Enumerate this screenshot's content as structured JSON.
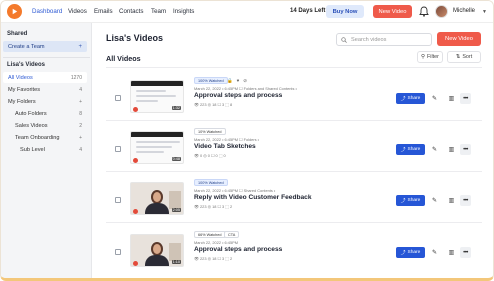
{
  "nav": {
    "links": [
      "Dashboard",
      "Videos",
      "Emails",
      "Contacts",
      "Team",
      "Insights"
    ],
    "days_left": "14 Days Left",
    "buy_now": "Buy Now",
    "new_video": "New Video",
    "user_name": "Michelle",
    "active_link": "Dashboard"
  },
  "sidebar": {
    "shared_heading": "Shared",
    "create_team": "Create a Team",
    "create_team_icon": "plus-icon",
    "lisa_heading": "Lisa's Videos",
    "items": [
      {
        "label": "All Videos",
        "count": "1270"
      },
      {
        "label": "My Favorites",
        "count": "4"
      },
      {
        "label": "My Folders",
        "count": "+"
      },
      {
        "label": "Auto Folders",
        "count": "8"
      },
      {
        "label": "Sales Videos",
        "count": "2"
      },
      {
        "label": "Team Onboarding",
        "count": "+"
      },
      {
        "label": "Sub Level",
        "count": "4"
      }
    ]
  },
  "main": {
    "title": "Lisa's Videos",
    "search_placeholder": "Search videos",
    "new_video": "New Video",
    "section_title": "All Videos",
    "filter_label": "Filter",
    "sort_label": "Sort",
    "share_label": "Share"
  },
  "videos": [
    {
      "badge": "100% Watched",
      "badge_style": "watched",
      "extra_badge": "",
      "badge_icons": [
        "lock-icon",
        "heart-icon",
        "link-icon"
      ],
      "meta": "March 22, 2022 • 6:45PM  ☐ Folders and Shared Contents •",
      "title": "Approval steps and process",
      "stats": "👁 223   ◎ 18   ☐ 3   ⬚ 8",
      "thumb": "screen",
      "duration": "1:32"
    },
    {
      "badge": "10% Watched",
      "badge_style": "plain",
      "extra_badge": "",
      "badge_icons": [],
      "meta": "March 22, 2022 • 6:45PM  ☐ Folders •",
      "title": "Video Tab Sketches",
      "stats": "👁 0   ◎ 0   ☐ 0   ⬚ 0",
      "thumb": "screen",
      "duration": "0:48"
    },
    {
      "badge": "100% Watched",
      "badge_style": "watched",
      "extra_badge": "",
      "badge_icons": [],
      "meta": "March 22, 2022 • 6:45PM  ☐ Shared Contents •",
      "title": "Reply with Video Customer Feedback",
      "stats": "👁 223   ◎ 18   ☐ 3   ⬚ 2",
      "thumb": "person",
      "duration": "2:05"
    },
    {
      "badge": "66% Watched",
      "badge_style": "plain",
      "extra_badge": "CTA",
      "badge_icons": [],
      "meta": "March 22, 2022 • 6:45PM",
      "title": "Approval steps and process",
      "stats": "👁 223   ◎ 18   ☐ 3   ⬚ 2",
      "thumb": "person",
      "duration": "1:10"
    }
  ],
  "colors": {
    "accent": "#2656d6",
    "brand": "#f47a2b",
    "new_video": "#ef5a4a"
  }
}
